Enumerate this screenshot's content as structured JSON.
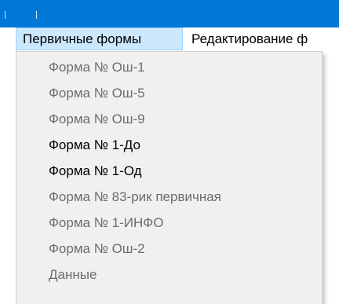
{
  "menubar": {
    "items": [
      {
        "label": "Первичные формы",
        "state": "open"
      },
      {
        "label": "Редактирование ф",
        "state": "normal"
      }
    ]
  },
  "dropdown": {
    "items": [
      {
        "label": "Форма № Ош-1",
        "enabled": false
      },
      {
        "label": "Форма № Ош-5",
        "enabled": false
      },
      {
        "label": "Форма № Ош-9",
        "enabled": false
      },
      {
        "label": "Форма № 1-До",
        "enabled": true
      },
      {
        "label": "Форма № 1-Од",
        "enabled": true
      },
      {
        "label": "Форма № 83-рик первичная",
        "enabled": false
      },
      {
        "label": "Форма № 1-ИНФО",
        "enabled": false
      },
      {
        "label": "Форма № Ош-2",
        "enabled": false
      },
      {
        "label": "Данные",
        "enabled": false
      }
    ]
  },
  "colors": {
    "titlebar": "#0078d7",
    "menu_highlight": "#cce8ff",
    "menu_highlight_border": "#99d1ff",
    "dropdown_bg": "#f0f0f0",
    "disabled_text": "#6d6d6d"
  }
}
